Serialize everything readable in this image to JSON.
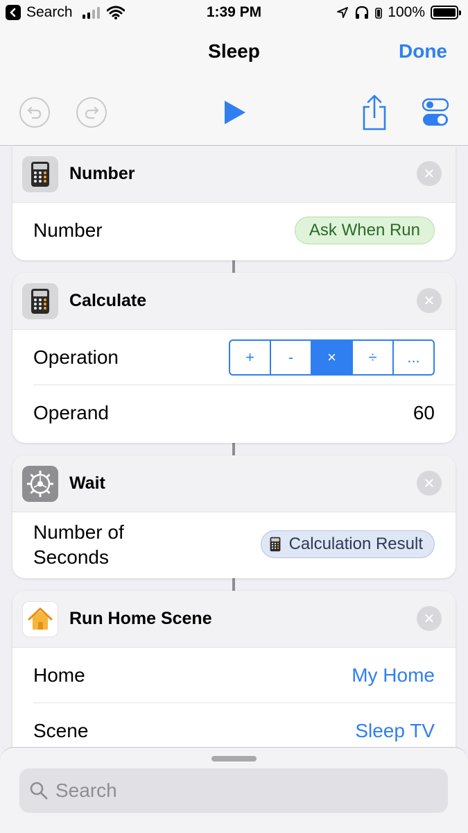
{
  "status_bar": {
    "back_label": "Search",
    "time": "1:39 PM",
    "battery": "100%"
  },
  "nav": {
    "title": "Sleep",
    "done_label": "Done"
  },
  "actions": [
    {
      "title": "Number",
      "icon": "calculator-icon",
      "rows": [
        {
          "label": "Number",
          "value": "Ask When Run"
        }
      ]
    },
    {
      "title": "Calculate",
      "icon": "calculator-icon",
      "rows": [
        {
          "label": "Operation",
          "operations": [
            "+",
            "-",
            "×",
            "÷",
            "..."
          ],
          "selected": "×"
        },
        {
          "label": "Operand",
          "value": "60"
        }
      ]
    },
    {
      "title": "Wait",
      "icon": "gear-icon",
      "rows": [
        {
          "label": "Number of Seconds",
          "label_line1": "Number of",
          "label_line2": "Seconds",
          "value": "Calculation Result"
        }
      ]
    },
    {
      "title": "Run Home Scene",
      "icon": "home-icon",
      "rows": [
        {
          "label": "Home",
          "value": "My Home"
        },
        {
          "label": "Scene",
          "value": "Sleep TV"
        }
      ]
    }
  ],
  "search": {
    "placeholder": "Search"
  },
  "colors": {
    "accent": "#2f7ff0",
    "ask_when_run_bg": "#dff3d8",
    "variable_bg": "#dfe6f5"
  }
}
